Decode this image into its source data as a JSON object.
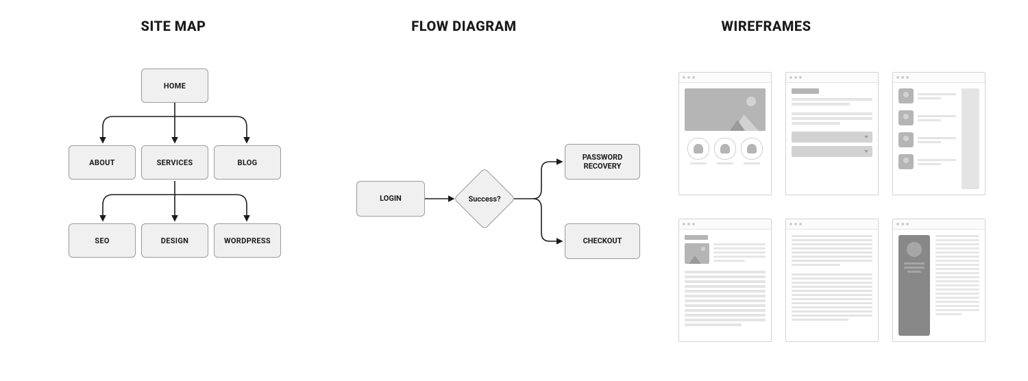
{
  "sections": {
    "sitemap_title": "SITE MAP",
    "flow_title": "FLOW DIAGRAM",
    "wireframes_title": "WIREFRAMES"
  },
  "sitemap": {
    "root": "HOME",
    "level2": [
      "ABOUT",
      "SERVICES",
      "BLOG"
    ],
    "level3": [
      "SEO",
      "DESIGN",
      "WORDPRESS"
    ]
  },
  "flow": {
    "start": "LOGIN",
    "decision": "Success?",
    "branch_top": "PASSWORD RECOVERY",
    "branch_bottom": "CHECKOUT"
  }
}
